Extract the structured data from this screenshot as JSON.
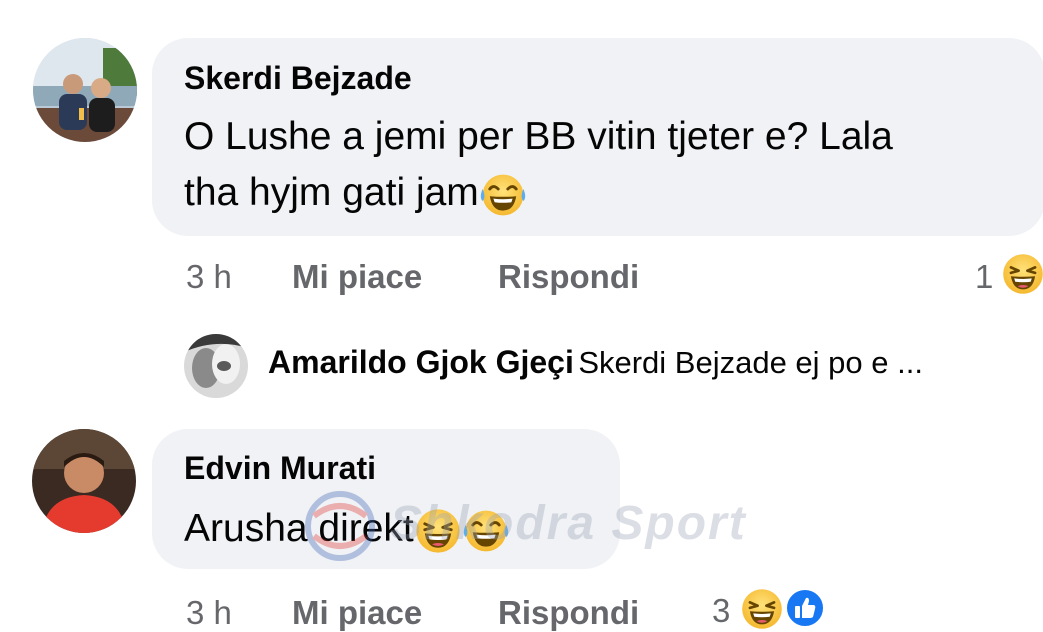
{
  "comments": [
    {
      "author": "Skerdi Bejzade",
      "text_line1": "O Lushe a jemi per BB vitin tjeter e? Lala",
      "text_line2": "tha hyjm gati jam",
      "time": "3 h",
      "like_label": "Mi piace",
      "reply_label": "Rispondi",
      "reaction_count": "1",
      "reaction_icon": "laughing-emoji-icon"
    },
    {
      "author": "Edvin Murati",
      "text": "Arusha direkt",
      "time": "3 h",
      "like_label": "Mi piace",
      "reply_label": "Rispondi",
      "reaction_count": "3",
      "reaction_icons": [
        "laughing-emoji-icon",
        "like-icon"
      ]
    }
  ],
  "reply_preview": {
    "author": "Amarildo Gjok Gjeçi",
    "text": "Skerdi Bejzade ej po e ..."
  },
  "watermark": "Shkodra Sport",
  "colors": {
    "bubble": "#f0f2f5",
    "meta_text": "#65676b",
    "like_blue": "#1877f2",
    "emoji_yellow": "#ffcc4d"
  }
}
